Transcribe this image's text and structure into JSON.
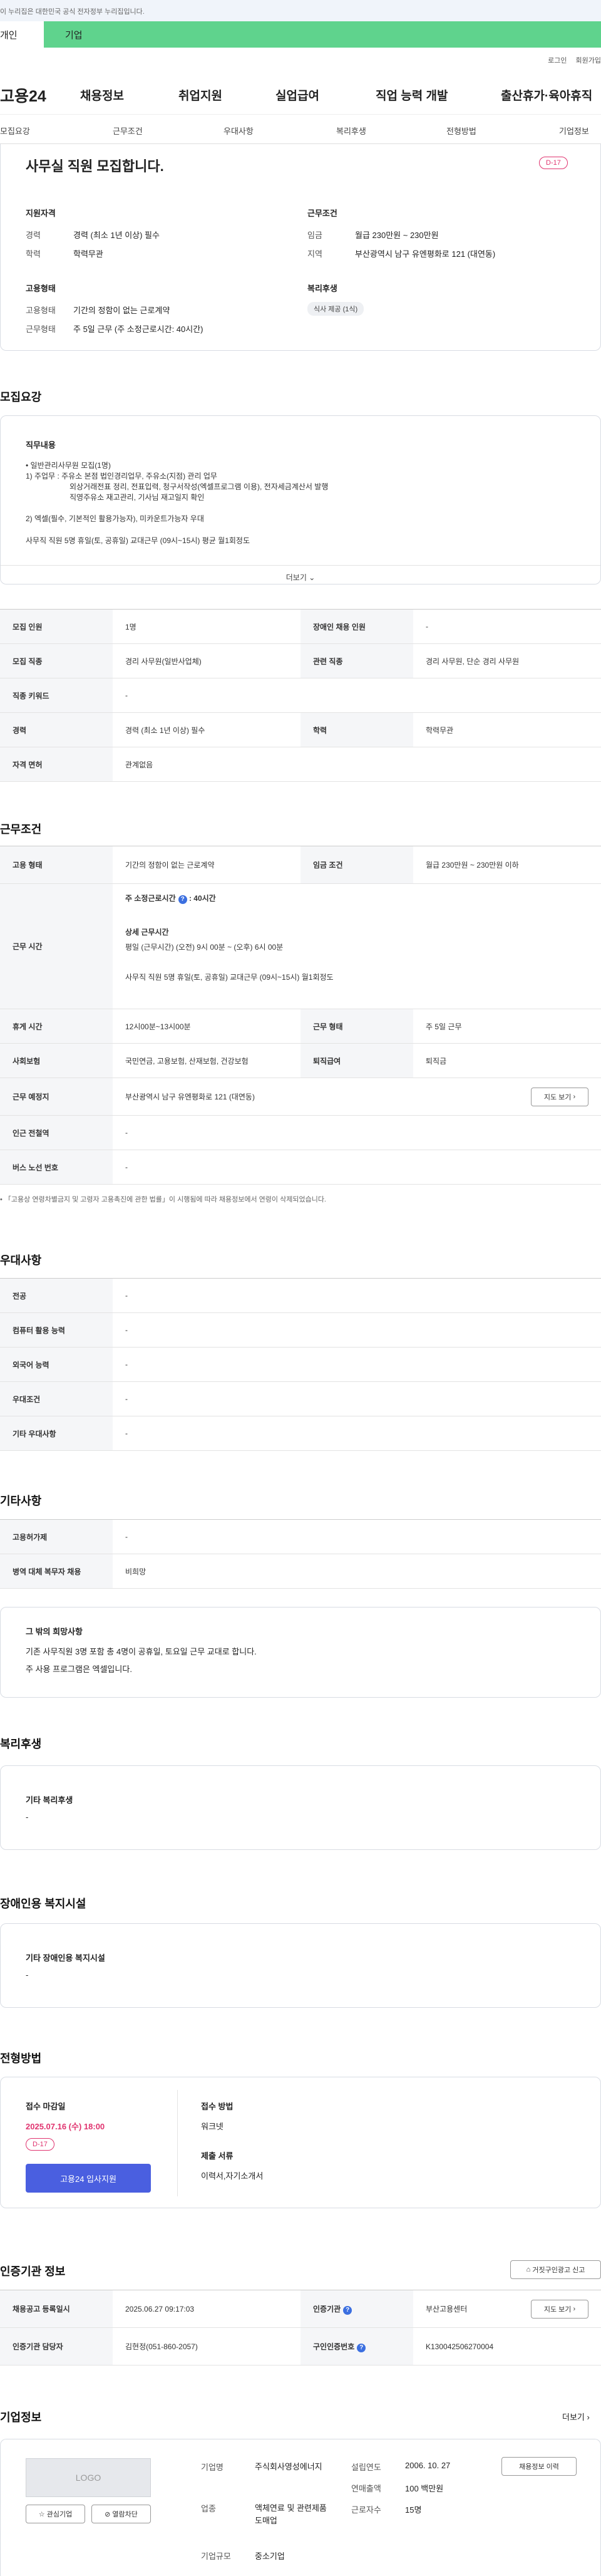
{
  "gov_notice": "이 누리집은 대한민국 공식 전자정부 누리집입니다.",
  "top_tabs": [
    "개인",
    "기업"
  ],
  "util_links": [
    "로그인",
    "회원가입"
  ],
  "logo": "고용24",
  "gnb": [
    "채용정보",
    "취업지원",
    "실업급여",
    "직업 능력 개발",
    "출산휴가·육아휴직"
  ],
  "sub_tabs": [
    "모집요강",
    "근무조건",
    "우대사항",
    "복리후생",
    "전형방법",
    "기업정보"
  ],
  "header": {
    "title": "사무실 직원 모집합니다.",
    "dday": "D-17",
    "qual_title": "지원자격",
    "cond_title": "근무조건",
    "emp_title": "고용형태",
    "welfare_title": "복리후생",
    "qual": [
      {
        "k": "경력",
        "v": "경력 (최소 1년 이상) 필수"
      },
      {
        "k": "학력",
        "v": "학력무관"
      }
    ],
    "cond": [
      {
        "k": "임금",
        "v": "월급 230만원 ~ 230만원"
      },
      {
        "k": "지역",
        "v": "부산광역시 남구 유엔평화로 121 (대연동)"
      }
    ],
    "emp": [
      {
        "k": "고용형태",
        "v": "기간의 정함이 없는 근로계약"
      },
      {
        "k": "근무형태",
        "v": "주 5일 근무 (주 소정근로시간: 40시간)"
      }
    ],
    "welfare_tag": "식사 제공 (1식)"
  },
  "recruit": {
    "title": "모집요강",
    "duty_title": "직무내용",
    "duty_lines": [
      "• 일반관리사무원 모집(1명)",
      "1) 주업무 : 주유소 본점 법인경리업무, 주유소(지점) 관리 업무",
      "외상거래전표 정리, 전표입력, 청구서작성(엑셀프로그램 이용), 전자세금계산서 발행",
      "직영주유소 재고관리, 기사님 재고일지 확인",
      "2) 엑셀(필수, 기본적인 활용가능자), 미카운트가능자 우대",
      "사무직 직원 5명 휴일(토, 공휴일) 교대근무 (09시~15시) 평균 월1회정도"
    ],
    "more": "더보기",
    "rows": [
      {
        "k1": "모집 인원",
        "v1": "1명",
        "k2": "장애인 채용 인원",
        "v2": "-"
      },
      {
        "k1": "모집 직종",
        "v1": "경리 사무원(일반사업체)",
        "k2": "관련 직종",
        "v2": "경리 사무원, 단순 경리 사무원"
      },
      {
        "k1": "직종 키워드",
        "v1": "-",
        "k2": "",
        "v2": ""
      },
      {
        "k1": "경력",
        "v1": "경력 (최소 1년 이상) 필수",
        "k2": "학력",
        "v2": "학력무관"
      },
      {
        "k1": "자격 면허",
        "v1": "관계없음",
        "k2": "",
        "v2": ""
      }
    ]
  },
  "work": {
    "title": "근무조건",
    "emp_k": "고용 형태",
    "emp_v": "기간의 정함이 없는 근로계약",
    "wage_k": "임금 조건",
    "wage_v": "월급 230만원 ~ 230만원 이하",
    "hours_k": "근무 시간",
    "hours_main": "주 소정근로시간",
    "hours_val": "40시간",
    "hours_detail_title": "상세 근무시간",
    "hours_detail": "평일 (근무시간) (오전) 9시 00분 ~ (오후) 6시 00분",
    "hours_extra": "사무직 직원 5명 휴일(토, 공휴일) 교대근무 (09시~15시) 월1회정도",
    "break_k": "휴게 시간",
    "break_v": "12시00분~13시00분",
    "form_k": "근무 형태",
    "form_v": "주 5일 근무",
    "ins_k": "사회보험",
    "ins_v": "국민연금, 고용보험, 산재보험, 건강보험",
    "ret_k": "퇴직급여",
    "ret_v": "퇴직금",
    "loc_k": "근무 예정지",
    "loc_v": "부산광역시 남구 유엔평화로 121 (대연동)",
    "map_btn": "지도 보기",
    "subway_k": "인근 전철역",
    "subway_v": "-",
    "bus_k": "버스 노선 번호",
    "bus_v": "-",
    "notice": "「고용상 연령차별금지 및 고령자 고용촉진에 관한 법률」이 시행됨에 따라 채용정보에서 연령이 삭제되었습니다."
  },
  "pref": {
    "title": "우대사항",
    "rows": [
      {
        "k": "전공",
        "v": "-"
      },
      {
        "k": "컴퓨터 활용 능력",
        "v": "-"
      },
      {
        "k": "외국어 능력",
        "v": "-"
      },
      {
        "k": "우대조건",
        "v": "-"
      },
      {
        "k": "기타 우대사항",
        "v": "-"
      }
    ]
  },
  "etc": {
    "title": "기타사항",
    "rows": [
      {
        "k": "고용허가제",
        "v": "-"
      },
      {
        "k": "병역 대체 복무자 채용",
        "v": "비희망"
      }
    ],
    "box_title": "그 밖의 희망사항",
    "box_lines": [
      "기존 사무직원 3명 포함 총 4명이 공휴일, 토요일 근무 교대로 합니다.",
      "주 사용 프로그램은 엑셀입니다."
    ]
  },
  "welfare": {
    "title": "복리후생",
    "sub": "기타 복리후생",
    "val": "-"
  },
  "disabled": {
    "title": "장애인용 복지시설",
    "sub": "기타 장애인용 복지시설",
    "val": "-"
  },
  "selection": {
    "title": "전형방법",
    "deadline_title": "접수 마감일",
    "deadline": "2025.07.16 (수) 18:00",
    "dday": "D-17",
    "apply_btn": "고용24 입사지원",
    "method_title": "접수 방법",
    "method": "워크넷",
    "docs_title": "제출 서류",
    "docs": "이력서,자기소개서"
  },
  "cert": {
    "title": "인증기관 정보",
    "report_btn": "거짓구인광고 신고",
    "rows": [
      {
        "k1": "채용공고 등록일시",
        "v1": "2025.06.27 09:17:03",
        "k2": "인증기관",
        "v2": "부산고용센터",
        "btn": "지도 보기"
      },
      {
        "k1": "인증기관 담당자",
        "v1": "김현정(051-860-2057)",
        "k2": "구인인증번호",
        "v2": "K130042506270004",
        "btn": ""
      }
    ]
  },
  "company": {
    "title": "기업정보",
    "more": "더보기",
    "logo": "LOGO",
    "fav": "관심기업",
    "block": "열람차단",
    "name_k": "기업명",
    "name_v": "주식회사영성에너지",
    "industry_k": "업종",
    "industry_v": "액체연료 및 관련제품 도매업",
    "size_k": "기업규모",
    "size_v": "중소기업",
    "est_k": "설립연도",
    "est_v": "2006. 10. 27",
    "sales_k": "연매출액",
    "sales_v": "100 백만원",
    "emp_k": "근로자수",
    "emp_v": "15명",
    "jobs_btn": "채용정보 이력"
  }
}
